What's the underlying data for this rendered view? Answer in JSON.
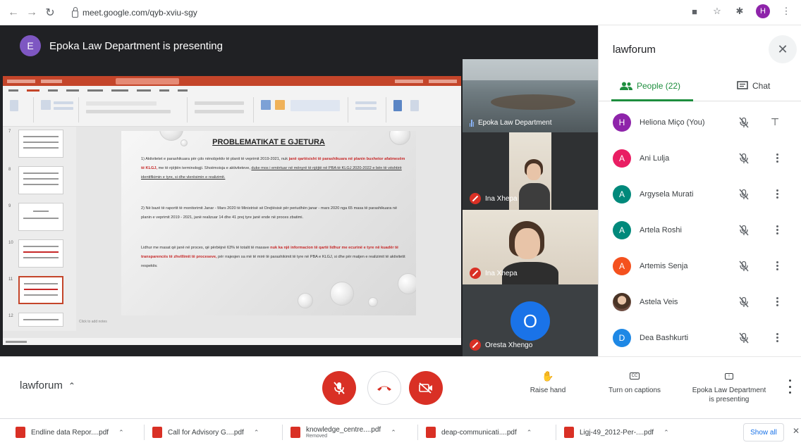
{
  "browser": {
    "url": "meet.google.com/qyb-xviu-sgy",
    "profile_initial": "H"
  },
  "stage": {
    "presenter_initial": "E",
    "banner": "Epoka Law Department is presenting"
  },
  "slide": {
    "title": "PROBLEMATIKAT E GJETURA",
    "p1_a": "1) Aktivitetet e parashikuara për çdo nënobjektiv të planit të veprimit 2019-2021, nuk",
    "p1_red": "janë qartësisht të parashikuara në planin buxhetor afatmesëm të KLGJ,",
    "p1_b": "me të njëjtën terminologji. Shoëmoisja e aktiviteteve,",
    "p1_ul": "duke mos i emërtuar në mënyrë të njëjtë në PBA të KLGJ 2020-2022 e bën të vështirë identifikimin e tyre, si dhe vlerësimin e realizimit.",
    "p2": "2) Në bazë të raportit të monitorimit Janar - Mars 2020 të Ministrisë së Drejtësisë për periudhën janar - mars 2020 nga 65 masa të parashikuara në planin e veprimit 2019 - 2021, janë realizuar 14 dhe 41 prej tyre janë ende në proces zbatimi.",
    "p3_a": "Lidhur me masat që janë në proces, që përbëjnë 63% të totalit të masave",
    "p3_red": "nuk ka një informacion të qartë lidhur me ecurinë e tyre në kuadër të transparencës të zhvillimit të proceseve,",
    "p3_b": "për rrajesjen sa më të mirë të parashikimit të tyre në PBA e KLGJ, si dhe për matjen e realizimit të aktivitetit respektiv.",
    "notes": "Click to add notes"
  },
  "tiles": [
    {
      "name": "Epoka Law Department"
    },
    {
      "name": "Ina Xhepa"
    },
    {
      "name": "Ina Xhepa"
    },
    {
      "name": "Oresta Xhengo",
      "initial": "O"
    }
  ],
  "panel": {
    "title": "lawforum",
    "tab_people": "People (22)",
    "tab_chat": "Chat",
    "people": [
      {
        "name": "Heliona Miço (You)",
        "initial": "H",
        "color": "#8e24aa"
      },
      {
        "name": "Ani Lulja",
        "initial": "A",
        "color": "#e91e63"
      },
      {
        "name": "Argysela Murati",
        "initial": "A",
        "color": "#00897b"
      },
      {
        "name": "Artela Roshi",
        "initial": "A",
        "color": "#00897b"
      },
      {
        "name": "Artemis Senja",
        "initial": "A",
        "color": "#f4511e"
      },
      {
        "name": "Astela Veis",
        "initial": "",
        "color": "#5d4037"
      },
      {
        "name": "Dea Bashkurti",
        "initial": "D",
        "color": "#1e88e5"
      }
    ]
  },
  "bottom": {
    "meeting_name": "lawforum",
    "raise_hand": "Raise hand",
    "captions": "Turn on captions",
    "presenting_1": "Epoka Law Department",
    "presenting_2": "is presenting"
  },
  "downloads": {
    "items": [
      {
        "name": "Endline data Repor....pdf",
        "sub": ""
      },
      {
        "name": "Call for Advisory G....pdf",
        "sub": ""
      },
      {
        "name": "knowledge_centre....pdf",
        "sub": "Removed"
      },
      {
        "name": "deap-communicati....pdf",
        "sub": ""
      },
      {
        "name": "Ligj-49_2012-Per-....pdf",
        "sub": ""
      }
    ],
    "show_all": "Show all"
  }
}
